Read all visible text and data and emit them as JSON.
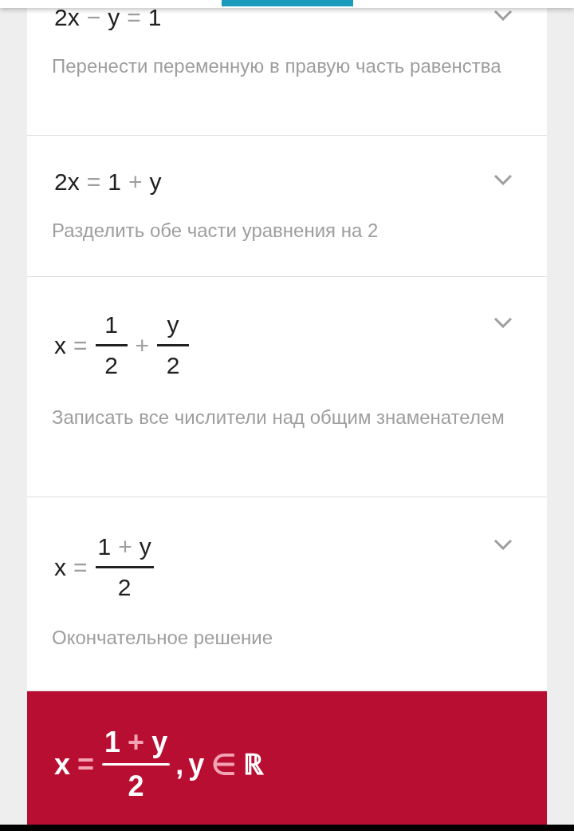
{
  "steps": [
    {
      "expanded": false,
      "equation": [
        {
          "kind": "term",
          "text": "2x"
        },
        {
          "kind": "op",
          "text": "−"
        },
        {
          "kind": "term",
          "text": "y"
        },
        {
          "kind": "op",
          "text": "="
        },
        {
          "kind": "term",
          "text": "1"
        }
      ],
      "description": "Перенести переменную в правую часть равенства"
    },
    {
      "expanded": false,
      "equation": [
        {
          "kind": "term",
          "text": "2x"
        },
        {
          "kind": "op",
          "text": "="
        },
        {
          "kind": "term",
          "text": "1"
        },
        {
          "kind": "op",
          "text": "+"
        },
        {
          "kind": "term",
          "text": "y"
        }
      ],
      "description": "Разделить обе части уравнения на 2"
    },
    {
      "expanded": false,
      "equation": [
        {
          "kind": "term",
          "text": "x"
        },
        {
          "kind": "op",
          "text": "="
        },
        {
          "kind": "frac",
          "numerator": [
            {
              "kind": "term",
              "text": "1"
            }
          ],
          "denominator": [
            {
              "kind": "term",
              "text": "2"
            }
          ]
        },
        {
          "kind": "op",
          "text": "+"
        },
        {
          "kind": "frac",
          "numerator": [
            {
              "kind": "term",
              "text": "y"
            }
          ],
          "denominator": [
            {
              "kind": "term",
              "text": "2"
            }
          ]
        }
      ],
      "description": "Записать все числители над общим знаменателем"
    },
    {
      "expanded": false,
      "equation": [
        {
          "kind": "term",
          "text": "x"
        },
        {
          "kind": "op",
          "text": "="
        },
        {
          "kind": "frac",
          "numerator": [
            {
              "kind": "term",
              "text": "1"
            },
            {
              "kind": "op",
              "text": "+"
            },
            {
              "kind": "term",
              "text": "y"
            }
          ],
          "denominator": [
            {
              "kind": "term",
              "text": "2"
            }
          ]
        }
      ],
      "description": "Окончательное решение"
    }
  ],
  "result": {
    "equation": [
      {
        "kind": "term",
        "text": "x"
      },
      {
        "kind": "op",
        "text": "="
      },
      {
        "kind": "frac",
        "numerator": [
          {
            "kind": "term",
            "text": "1"
          },
          {
            "kind": "op",
            "text": "+"
          },
          {
            "kind": "term",
            "text": "y"
          }
        ],
        "denominator": [
          {
            "kind": "term",
            "text": "2"
          }
        ]
      },
      {
        "kind": "term",
        "text": ","
      },
      {
        "kind": "term",
        "text": "y"
      },
      {
        "kind": "op",
        "text": "∈"
      },
      {
        "kind": "term",
        "text": "ℝ"
      }
    ]
  }
}
